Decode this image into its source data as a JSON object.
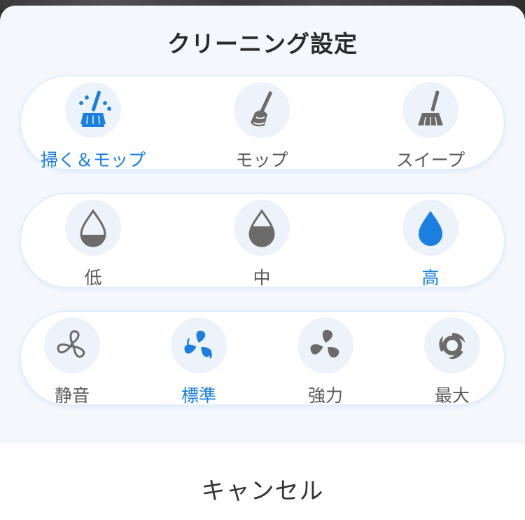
{
  "sheet": {
    "title": "クリーニング設定",
    "cancel_label": "キャンセル"
  },
  "colors": {
    "accent": "#1a7fe0",
    "inactive": "#5a5a5a",
    "icon_gray": "#6b6b6b"
  },
  "cleaning_mode": {
    "options": [
      {
        "label": "掃く＆モップ",
        "icon": "sweep-mop-icon",
        "selected": true
      },
      {
        "label": "モップ",
        "icon": "mop-icon",
        "selected": false
      },
      {
        "label": "スイープ",
        "icon": "broom-icon",
        "selected": false
      }
    ]
  },
  "water_level": {
    "options": [
      {
        "label": "低",
        "icon": "water-drop-low-icon",
        "selected": false
      },
      {
        "label": "中",
        "icon": "water-drop-medium-icon",
        "selected": false
      },
      {
        "label": "高",
        "icon": "water-drop-high-icon",
        "selected": true
      }
    ]
  },
  "suction_power": {
    "options": [
      {
        "label": "静音",
        "icon": "fan-quiet-icon",
        "selected": false
      },
      {
        "label": "標準",
        "icon": "fan-standard-icon",
        "selected": true
      },
      {
        "label": "強力",
        "icon": "fan-strong-icon",
        "selected": false
      },
      {
        "label": "最大",
        "icon": "fan-max-icon",
        "selected": false
      }
    ]
  }
}
